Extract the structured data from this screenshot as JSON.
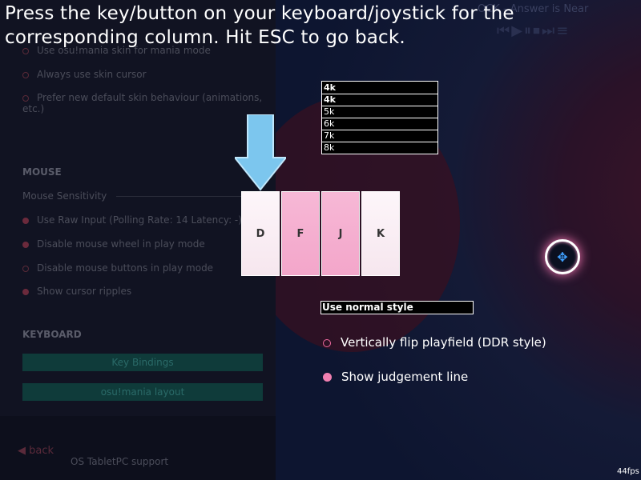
{
  "instruction": "Press the key/button on your keyboard/joystick for the corresponding column. Hit ESC to go back.",
  "now_playing": "OCK - Answer is Near",
  "background_settings": {
    "options_top": [
      "Use osu!mania skin for mania mode",
      "Always use skin cursor",
      "Prefer new default skin behaviour (animations, etc.)"
    ],
    "mouse_section": "MOUSE",
    "mouse_sensitivity_label": "Mouse Sensitivity",
    "mouse_options": [
      "Use Raw Input (Polling Rate: 14 Latency: -)",
      "Disable mouse wheel in play mode",
      "Disable mouse buttons in play mode",
      "Show cursor ripples"
    ],
    "keyboard_section": "KEYBOARD",
    "key_bindings_button": "Key Bindings",
    "layout_button": "osu!mania layout",
    "back_label": "back",
    "tablet_label": "OS TabletPC support"
  },
  "key_count_dropdown": {
    "selected": "4k",
    "options": [
      "4k",
      "5k",
      "6k",
      "7k",
      "8k"
    ]
  },
  "columns": [
    "D",
    "F",
    "J",
    "K"
  ],
  "style_dropdown": {
    "selected": "Use normal style"
  },
  "toggles": [
    {
      "label": "Vertically flip playfield (DDR style)",
      "checked": false
    },
    {
      "label": "Show judgement line",
      "checked": true
    }
  ],
  "fps": "44fps",
  "colors": {
    "accent": "#f07fb0",
    "pink_key": "#f5b0d2",
    "white_key": "#faf0f5",
    "arrow": "#7cc6ee"
  }
}
